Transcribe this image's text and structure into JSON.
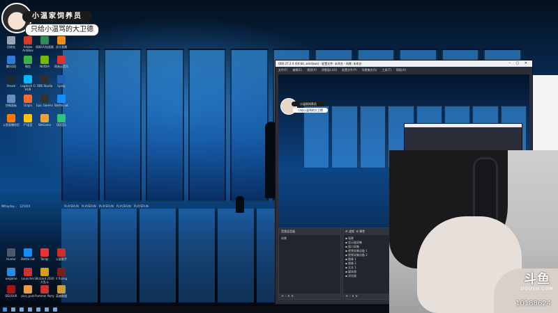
{
  "banner": {
    "name": "小温家饲养员",
    "slogan": "只给小温骂的大卫德"
  },
  "desktop_icons": [
    {
      "label": "回收站",
      "color": "#9aa4b2"
    },
    {
      "label": "Adobe AntiBox",
      "color": "#d23a2a"
    },
    {
      "label": "网易UU加速器",
      "color": "#2e8b57"
    },
    {
      "label": "虎牙直播",
      "color": "#f28b1a"
    },
    {
      "label": "腾讯QQ",
      "color": "#2b7cd3"
    },
    {
      "label": "微信",
      "color": "#3cb34a"
    },
    {
      "label": "NVIDIA",
      "color": "#76b900"
    },
    {
      "label": "网易云音乐",
      "color": "#d33"
    },
    {
      "label": "Steam",
      "color": "#1b2838"
    },
    {
      "label": "Logitech G HUB",
      "color": "#00b8fc"
    },
    {
      "label": "OBS Studio",
      "color": "#302e31"
    },
    {
      "label": "Uplay",
      "color": "#1f5fb4"
    },
    {
      "label": "控制面板",
      "color": "#6a8cc0"
    },
    {
      "label": "Origin",
      "color": "#f56c2d"
    },
    {
      "label": "Epic Games",
      "color": "#333"
    },
    {
      "label": "Battle.net",
      "color": "#148eff"
    },
    {
      "label": "斗鱼直播伴侣",
      "color": "#ff7800"
    },
    {
      "label": "YY语音",
      "color": "#ffc400"
    },
    {
      "label": "WeGame",
      "color": "#e8a33d"
    },
    {
      "label": "QQ音乐",
      "color": "#31c27c"
    },
    {
      "label": "Hunter",
      "color": "#4a5a6a"
    },
    {
      "label": "Battle.net",
      "color": "#148eff"
    },
    {
      "label": "Telegr",
      "color": "#e33"
    },
    {
      "label": "火星助手",
      "color": "#c9302c"
    },
    {
      "label": "wegame",
      "color": "#2b8be0"
    },
    {
      "label": "Launcher",
      "color": "#c33"
    },
    {
      "label": "Blizzard 2020 大乱斗",
      "color": "#d4a017"
    },
    {
      "label": "V Rising",
      "color": "#7a1f1f"
    },
    {
      "label": "DEVOUR",
      "color": "#a31515"
    },
    {
      "label": "pico_park",
      "color": "#e94"
    },
    {
      "label": "Pummel Party",
      "color": "#c33"
    },
    {
      "label": "英雄联盟",
      "color": "#c89b3c"
    }
  ],
  "desktop_shortcuts": {
    "row_labels": [
      "PLAYERUN",
      "PLAYERUN",
      "PLAYERUN",
      "PLAYERUN",
      "PLAYERUN"
    ],
    "folder_labels": [
      "NPlayday...",
      "125410"
    ]
  },
  "obs": {
    "title": "OBS 27.2.4 (64-bit, windows) - 配置文件: 未命名 - 场景: 未命名",
    "menu": [
      "文件(F)",
      "编辑(E)",
      "视图(V)",
      "停靠窗口(D)",
      "配置文件(P)",
      "场景集合(S)",
      "工具(T)",
      "帮助(H)"
    ],
    "mini_banner_name": "小温家饲养员",
    "mini_banner_slogan": "只给小温骂的大卫德",
    "docks": {
      "audio_mixer": "音频混音器",
      "filters": "滤镜",
      "properties": "属性",
      "scenes": "场景",
      "sources": "来源",
      "source_items": [
        "场景",
        "显示器采集",
        "窗口采集",
        "视频采集设备 1",
        "视频采集设备 2",
        "图像 1",
        "图像 2",
        "文本 1",
        "媒体源",
        "浏览器"
      ],
      "footer_controls": "+ - ∧ ∨"
    }
  },
  "webcam": {
    "logo_cn": "斗鱼",
    "logo_en": "DOUYU.COM",
    "room_id": "10188624"
  },
  "colors": {
    "accent_blue": "#0b4a8a",
    "obs_bg": "#2b2e38",
    "douyu": "#ffffff"
  }
}
